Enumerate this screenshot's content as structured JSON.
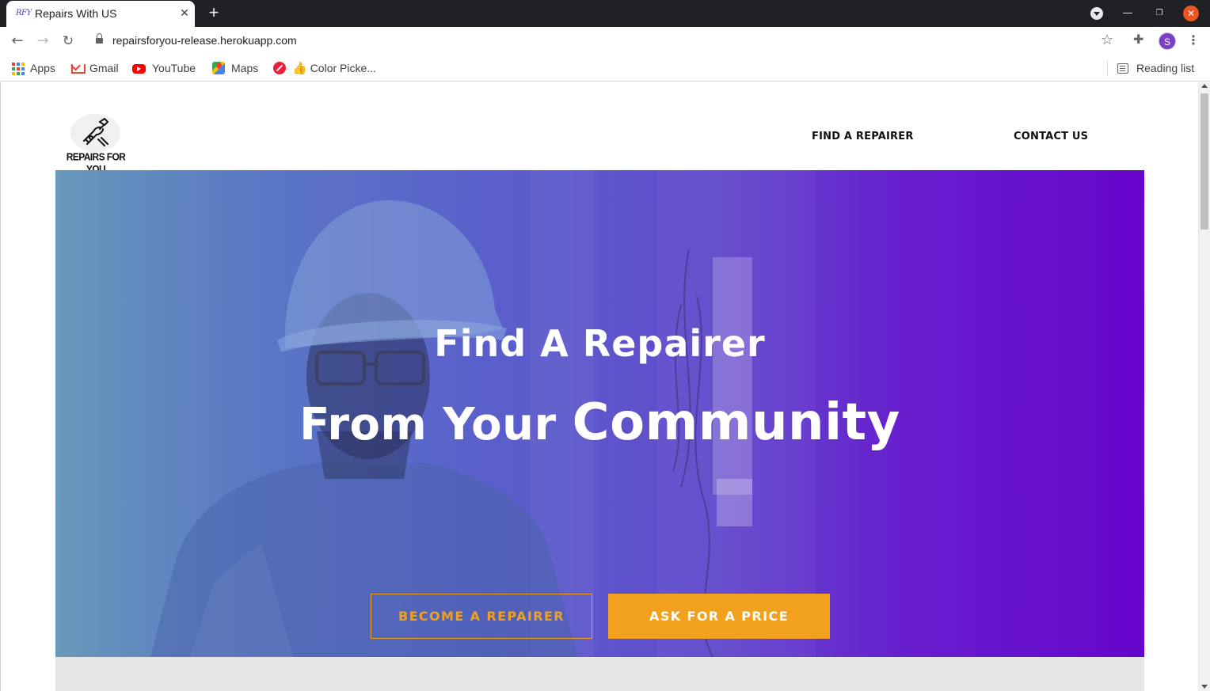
{
  "browser": {
    "tab": {
      "favicon_text": "RFY",
      "title": "Repairs With US"
    },
    "url": "repairsforyou-release.herokuapp.com",
    "profile_initial": "S",
    "bookmarks": [
      {
        "label": "Apps",
        "icon": "apps-grid-icon"
      },
      {
        "label": "Gmail",
        "icon": "gmail-icon"
      },
      {
        "label": "YouTube",
        "icon": "youtube-icon"
      },
      {
        "label": "Maps",
        "icon": "maps-icon"
      },
      {
        "label": "Color Picke...",
        "icon": "color-picker-icon"
      }
    ],
    "reading_list": "Reading list"
  },
  "site": {
    "logo_text": "REPAIRS FOR YOU",
    "nav": [
      {
        "label": "FIND A REPAIRER"
      },
      {
        "label": "CONTACT US"
      }
    ],
    "hero": {
      "title_line1": "Find A Repairer",
      "title_line2_prefix": "From Your",
      "title_line2_emphasis": "Community",
      "buttons": [
        {
          "label": "BECOME A REPAIRER",
          "style": "outline"
        },
        {
          "label": "ASK FOR A PRICE",
          "style": "filled"
        }
      ],
      "gradient_colors": [
        "#5b8fb4",
        "#6605cb"
      ],
      "accent_color": "#f1a11e"
    }
  }
}
